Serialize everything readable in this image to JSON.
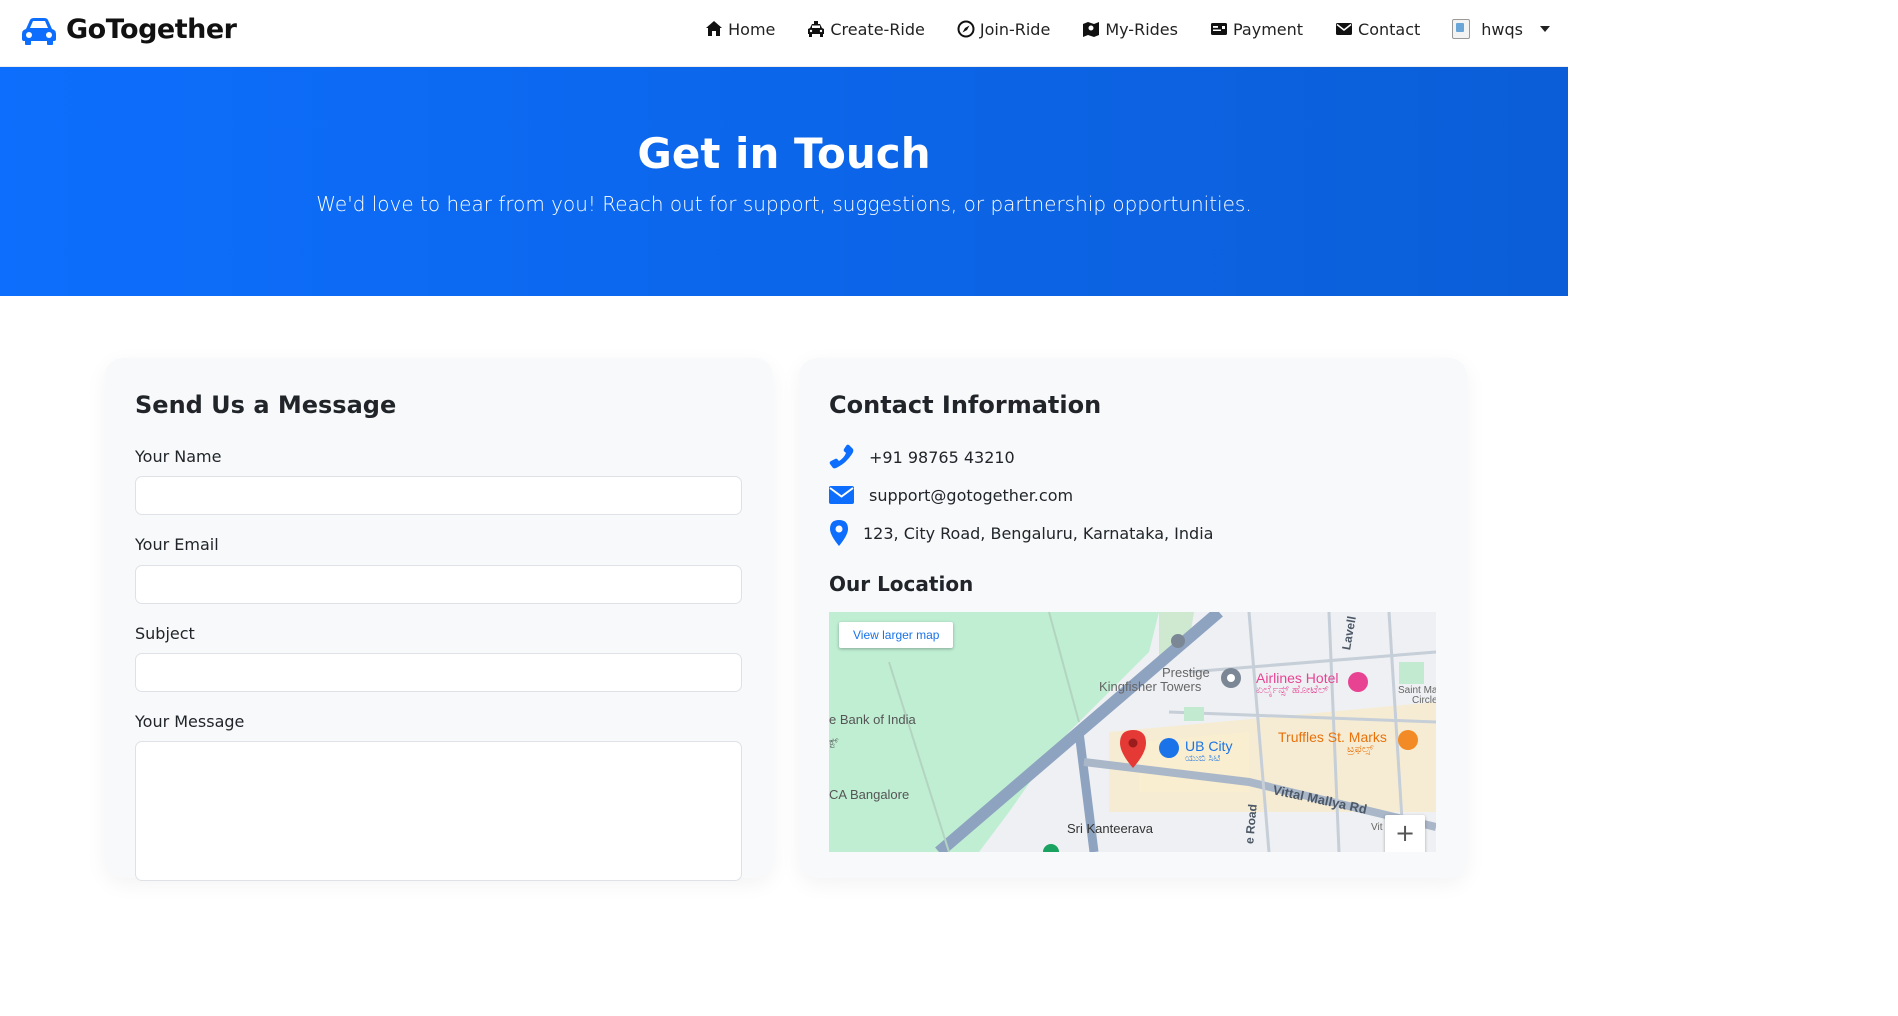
{
  "brand": {
    "name": "GoTogether",
    "icon": "car-icon",
    "color": "#0d6efd"
  },
  "nav": {
    "items": [
      {
        "label": "Home",
        "icon": "home-icon"
      },
      {
        "label": "Create-Ride",
        "icon": "taxi-icon"
      },
      {
        "label": "Join-Ride",
        "icon": "compass-icon"
      },
      {
        "label": "My-Rides",
        "icon": "map-icon"
      },
      {
        "label": "Payment",
        "icon": "money-icon"
      },
      {
        "label": "Contact",
        "icon": "envelope-icon"
      }
    ],
    "user": {
      "name": "hwqs",
      "avatar": "broken-image-icon"
    }
  },
  "hero": {
    "title": "Get in Touch",
    "subtitle": "We'd love to hear from you! Reach out for support, suggestions, or partnership opportunities.",
    "gradient": [
      "#0d6efd",
      "#0b5ed7"
    ]
  },
  "form": {
    "title": "Send Us a Message",
    "fields": [
      {
        "label": "Your Name",
        "value": ""
      },
      {
        "label": "Your Email",
        "value": ""
      },
      {
        "label": "Subject",
        "value": ""
      },
      {
        "label": "Your Message",
        "value": ""
      }
    ]
  },
  "contact": {
    "title": "Contact Information",
    "phone": "+91 98765 43210",
    "email": "support@gotogether.com",
    "address": "123, City Road, Bengaluru, Karnataka, India",
    "icon_color": "#0d6efd"
  },
  "location": {
    "title": "Our Location",
    "view_larger": "View larger map",
    "zoom_in": "+",
    "labels": {
      "prestige": "Prestige",
      "kingfisher": "Kingfisher Towers",
      "airlines": "Airlines Hotel",
      "airlines_kn": "ಏರ್ಲೈನ್ಸ್ ಹೋಟೆಲ್",
      "saint_marks": "Saint Ma",
      "circle": "Circle",
      "bank": "e Bank of India",
      "bank_kn": "ಕ್ಟ್",
      "ub_city": "UB City",
      "ub_city_kn": "ಯುಬಿ ಸಿಟಿ",
      "truffles": "Truffles St. Marks",
      "truffles_kn": "ಟ್ರಫಲ್ಸ್",
      "ca": "CA Bangalore",
      "vittal": "Vittal Mallya Rd",
      "kanteerava": "Sri Kanteerava",
      "lavelle": "Lavell",
      "road": "e Road",
      "vit": "Vit"
    }
  }
}
